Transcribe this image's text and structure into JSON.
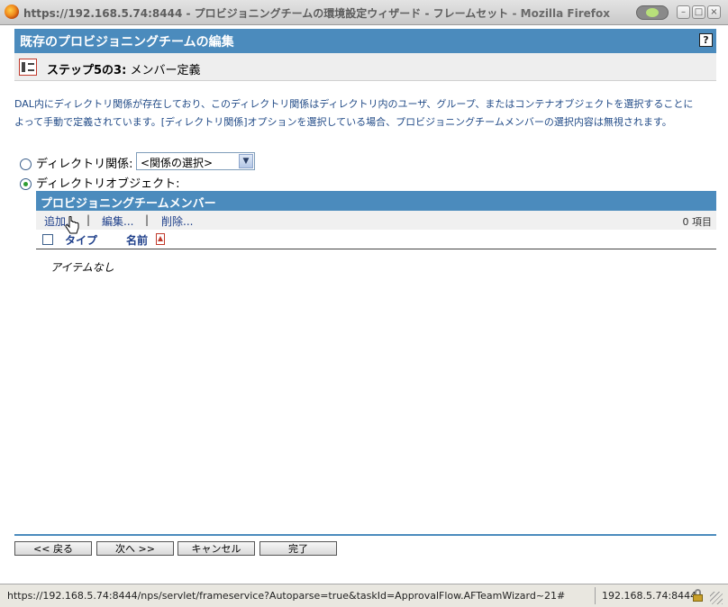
{
  "window": {
    "title": "https://192.168.5.74:8444 - プロビジョニングチームの環境設定ウィザード - フレームセット",
    "app_name": "- Mozilla Firefox",
    "buttons": {
      "minimize": "–",
      "maximize": "□",
      "close": "×"
    }
  },
  "page": {
    "header": "既存のプロビジョニングチームの編集",
    "help": "?",
    "step_label": "ステップ5の3:",
    "step_title": "メンバー定義",
    "description_line1": "DAL内にディレクトリ関係が存在しており、このディレクトリ関係はディレクトリ内のユーザ、グループ、またはコンテナオブジェクトを選択することに",
    "description_line2": "よって手動で定義されています。[ディレクトリ関係]オプションを選択している場合、プロビジョニングチームメンバーの選択内容は無視されます。",
    "options": {
      "relationship_label": "ディレクトリ関係:",
      "relationship_selected": false,
      "relationship_select_value": "<関係の選択>",
      "object_label": "ディレクトリオブジェクト:",
      "object_selected": true
    },
    "members": {
      "title": "プロビジョニングチームメンバー",
      "add": "追加...",
      "edit": "編集...",
      "delete": "削除...",
      "separator": "|",
      "count": "0 項目",
      "col_type": "タイプ",
      "col_name": "名前",
      "empty": "アイテムなし"
    },
    "buttons": {
      "back": "<< 戻る",
      "next": "次へ >>",
      "cancel": "キャンセル",
      "finish": "完了"
    }
  },
  "statusbar": {
    "url": "https://192.168.5.74:8444/nps/servlet/frameservice?Autoparse=true&taskId=ApprovalFlow.AFTeamWizard~21#",
    "host": "192.168.5.74:8444"
  },
  "colors": {
    "accent": "#4b8bbd",
    "link": "#1e3f8a",
    "description": "#234c88"
  }
}
